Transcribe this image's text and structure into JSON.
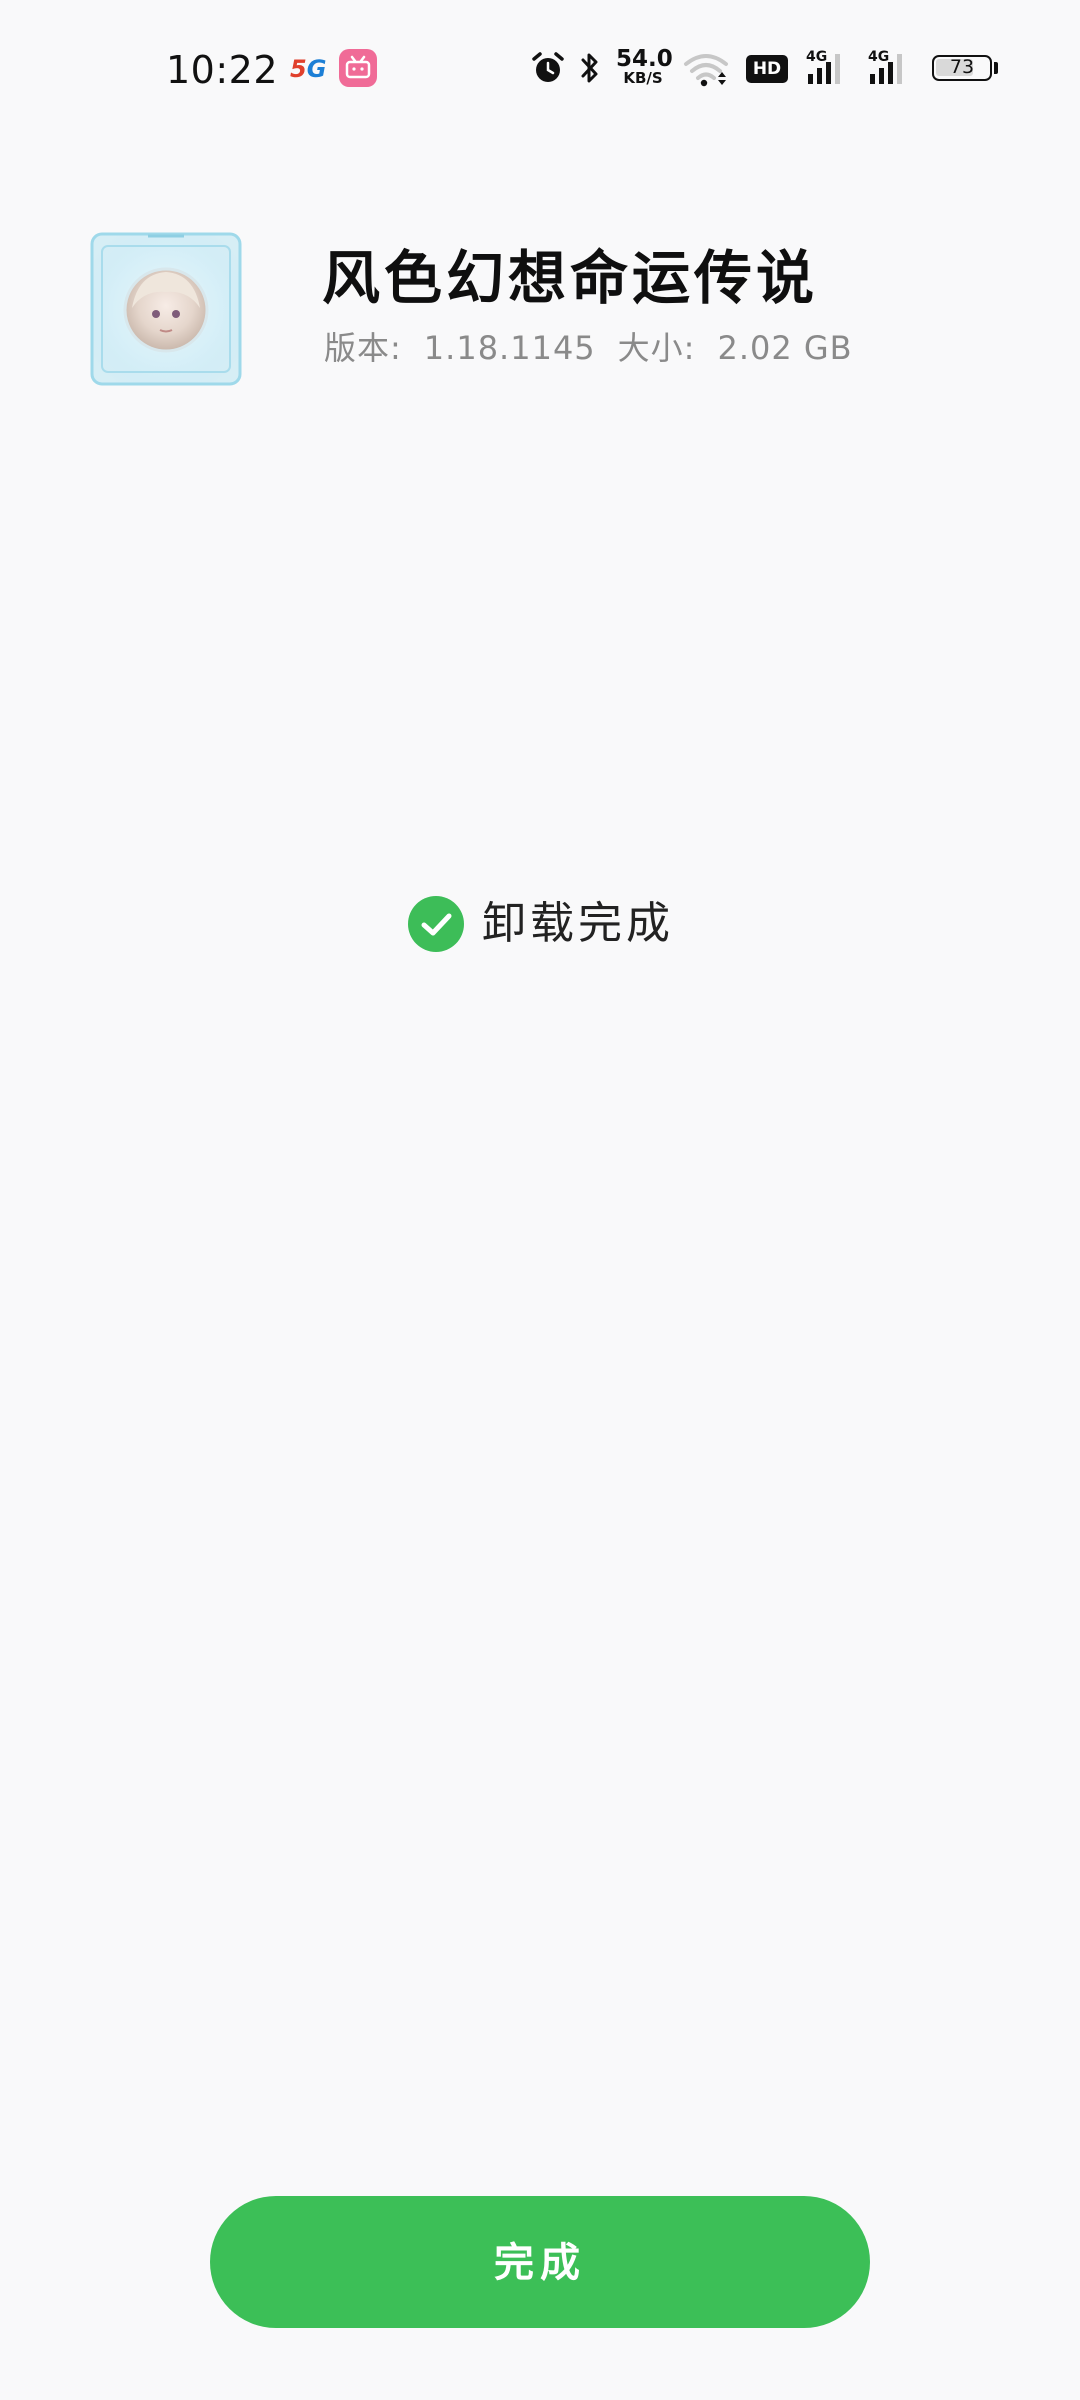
{
  "status_bar": {
    "time": "10:22",
    "network_badge": {
      "five": "5",
      "g": "G"
    },
    "notification_app_icon": "bilibili-icon",
    "alarm_icon": "alarm-clock-icon",
    "bluetooth_icon": "bluetooth-icon",
    "net_speed": {
      "value": "54.0",
      "unit": "KB/S"
    },
    "wifi_icon": "wifi-icon",
    "hd_badge": "HD",
    "signals": [
      {
        "label": "4G",
        "level": 0.75
      },
      {
        "label": "4G",
        "level": 0.75
      }
    ],
    "battery_percent": "73",
    "battery_level": 0.73
  },
  "app": {
    "name": "风色幻想命运传说",
    "version_label": "版本:",
    "version_value": "1.18.1145",
    "size_label": "大小:",
    "size_value": "2.02 GB",
    "icon": "game-character-avatar-icon"
  },
  "result": {
    "icon": "check-circle-icon",
    "text": "卸载完成"
  },
  "actions": {
    "done_label": "完成"
  },
  "colors": {
    "background": "#f9f9fa",
    "accent_green": "#3cbf57",
    "meta_gray": "#8a8a8a"
  }
}
